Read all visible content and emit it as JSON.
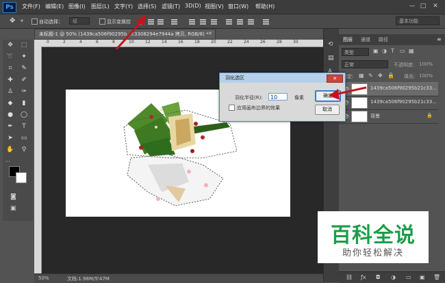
{
  "menubar": {
    "logo": "Ps",
    "items": [
      "文件(F)",
      "编辑(E)",
      "图像(I)",
      "图层(L)",
      "文字(Y)",
      "选择(S)",
      "滤镜(T)",
      "3D(D)",
      "视图(V)",
      "窗口(W)",
      "帮助(H)"
    ],
    "window_controls": [
      "—",
      "□",
      "✕"
    ]
  },
  "optionsbar": {
    "auto_select_label": "自动选择：",
    "auto_select_value": "组",
    "show_transform_label": "显示变换控",
    "workspace": "基本功能"
  },
  "document": {
    "tab_title": "未标题-1 @ 50% (1439ca506f90295b...c3308294e7944a 拷贝, RGB/8) *",
    "tab_close": "✕",
    "zoom": "50%",
    "doc_info": "文档:1.98M/5.47M"
  },
  "ruler_ticks": [
    "0",
    "2",
    "4",
    "6",
    "8",
    "10",
    "12",
    "14",
    "16",
    "18",
    "20",
    "22",
    "24",
    "26",
    "28",
    "30"
  ],
  "dialog": {
    "title": "羽化选区",
    "close": "✕",
    "radius_label": "羽化半径(R):",
    "radius_value": "10",
    "radius_unit": "像素",
    "ok_label": "确定",
    "cancel_label": "取消",
    "edge_label": "应用画布边界的效果"
  },
  "layers_panel": {
    "tabs": [
      "图层",
      "通道",
      "路径"
    ],
    "blend_mode": "正常",
    "opacity_label": "不透明度:",
    "opacity_value": "100%",
    "lock_label": "锁定:",
    "fill_label": "填充:",
    "fill_value": "100%",
    "kind_label": "类型",
    "layers": [
      {
        "name": "1439ca506f90295b21c33..."
      },
      {
        "name": "1439ca506f90295b21c33..."
      },
      {
        "name": "背景"
      }
    ],
    "bottom_icons": [
      "ƒx",
      "◘",
      "◑",
      "▭",
      "▣",
      "🗑"
    ]
  },
  "watermark": {
    "main": "百科全说",
    "sub": "助你轻松解决"
  },
  "colors": {
    "arrow_red": "#c0151d",
    "watermark_green": "#1d9e4a",
    "dialog_border": "#5b7fad"
  }
}
